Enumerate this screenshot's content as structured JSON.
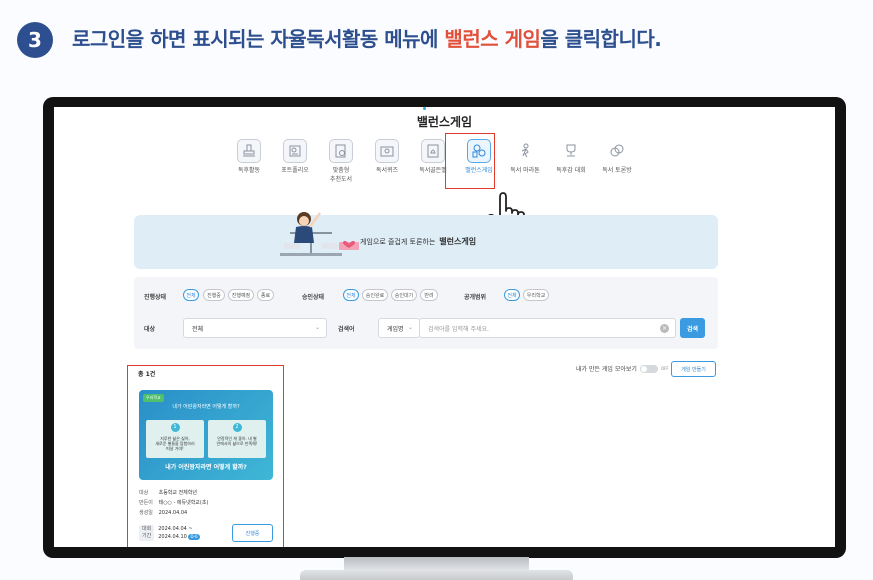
{
  "step": {
    "number": "3",
    "title_before": "로그인을 하면 표시되는 자율독서활동 메뉴에 ",
    "title_highlight": "밸런스 게임",
    "title_after": "을 클릭합니다."
  },
  "app": {
    "title": "밸런스게임"
  },
  "menu": {
    "items": [
      {
        "label": "독후활동",
        "icon": "stamp-icon"
      },
      {
        "label": "포트폴리오",
        "icon": "portfolio-icon"
      },
      {
        "label": "맞춤형\n추천도서",
        "icon": "recommend-book-icon"
      },
      {
        "label": "독서퀴즈",
        "icon": "quiz-icon"
      },
      {
        "label": "독서골든벨",
        "icon": "golden-bell-icon"
      },
      {
        "label": "밸런스게임",
        "icon": "balance-game-icon",
        "active": true
      },
      {
        "label": "독서 마라톤",
        "icon": "marathon-icon"
      },
      {
        "label": "독후감 대회",
        "icon": "trophy-icon"
      },
      {
        "label": "독서 토론방",
        "icon": "discussion-icon"
      }
    ]
  },
  "banner": {
    "text": "게임으로 즐겁게 토론하는",
    "brand": "밸런스게임"
  },
  "filters": {
    "progress_label": "진행상태",
    "progress_chips": [
      "전체",
      "진행중",
      "진행예정",
      "종료"
    ],
    "approval_label": "승인상태",
    "approval_chips": [
      "전체",
      "승인완료",
      "승인대기",
      "반려"
    ],
    "public_label": "공개범위",
    "public_chips": [
      "전체",
      "우리학교"
    ],
    "target_label": "대상",
    "target_value": "전체",
    "search_label": "검색어",
    "search_type": "게임명",
    "search_placeholder": "검색어를 입력해 주세요.",
    "search_button": "검색"
  },
  "list": {
    "total": "총 1건",
    "mine_label": "내가 만든 게임 모아보기",
    "mine_toggle": "OFF",
    "make_button": "게임 만들기"
  },
  "card": {
    "tag": "우리학교",
    "question": "내가 어린왕자라면 어떻게 할까?",
    "option1_num": "1",
    "option1_text": "지루한 삶은 싫어.\n새로운 별들을 탐험하러\n떠날 거야!",
    "option2_num": "2",
    "option2_text": "안정적인 게 좋아. 내 별\n안에서의 삶으로 만족해!",
    "main_title": "내가 어린왕자라면 어떻게 할까?",
    "target_key": "대상",
    "target_val": "초등학교 전체학년",
    "maker_key": "만든이",
    "maker_val": "테○○ - 에듀넷학교(초)",
    "created_key": "생성일",
    "created_val": "2024.04.04",
    "period_key1": "대회",
    "period_key2": "기간",
    "period_start": "2024.04.04 ~",
    "period_end": "2024.04.10",
    "dday": "D-6",
    "state_button": "진행중"
  }
}
